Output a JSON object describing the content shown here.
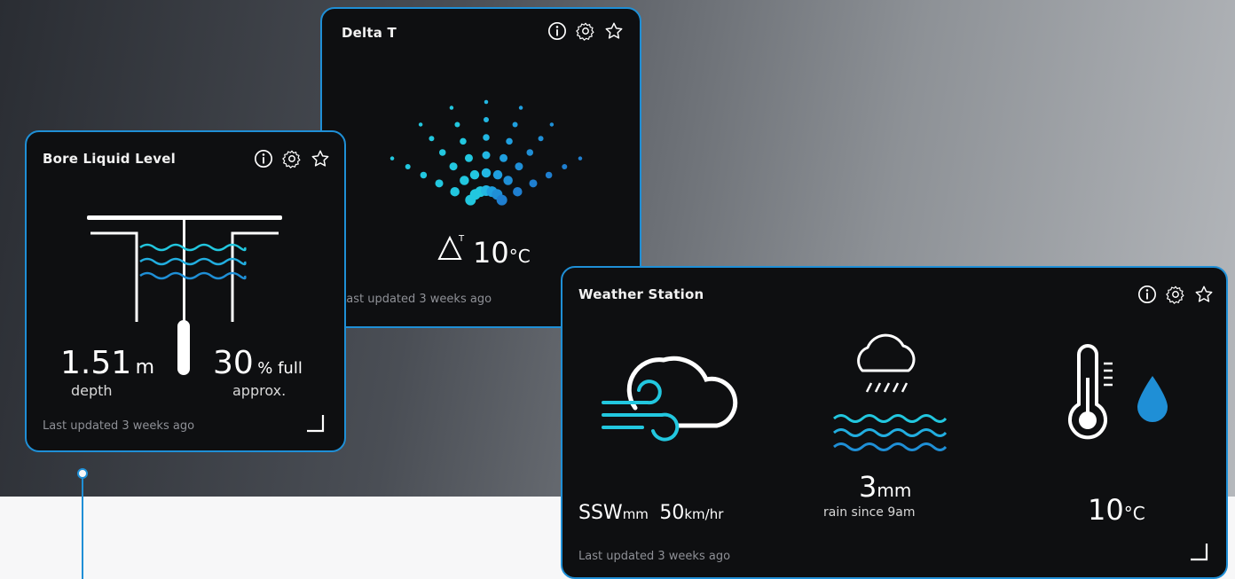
{
  "colors": {
    "accent": "#1f8fd6",
    "cyan": "#22c7df",
    "card_bg": "#0e0f11"
  },
  "cards": {
    "delta_t": {
      "title": "Delta T",
      "symbol": "ΔT",
      "value": "10",
      "unit": "°C",
      "updated": "Last updated 3 weeks ago"
    },
    "bore": {
      "title": "Bore Liquid Level",
      "depth_value": "1.51",
      "depth_unit": "m",
      "depth_label": "depth",
      "full_value": "30",
      "full_unit": "% full",
      "full_label": "approx.",
      "updated": "Last updated 3 weeks ago"
    },
    "weather": {
      "title": "Weather Station",
      "wind_dir": "SSW",
      "wind_dir_unit": "mm",
      "wind_speed": "50",
      "wind_speed_unit": "km/hr",
      "rain_value": "3",
      "rain_unit": "mm",
      "rain_label": "rain since 9am",
      "temp_value": "10",
      "temp_unit": "°C",
      "updated": "Last updated 3 weeks ago"
    }
  },
  "icons": [
    "info-icon",
    "gear-icon",
    "star-icon",
    "expand-corner-icon"
  ]
}
